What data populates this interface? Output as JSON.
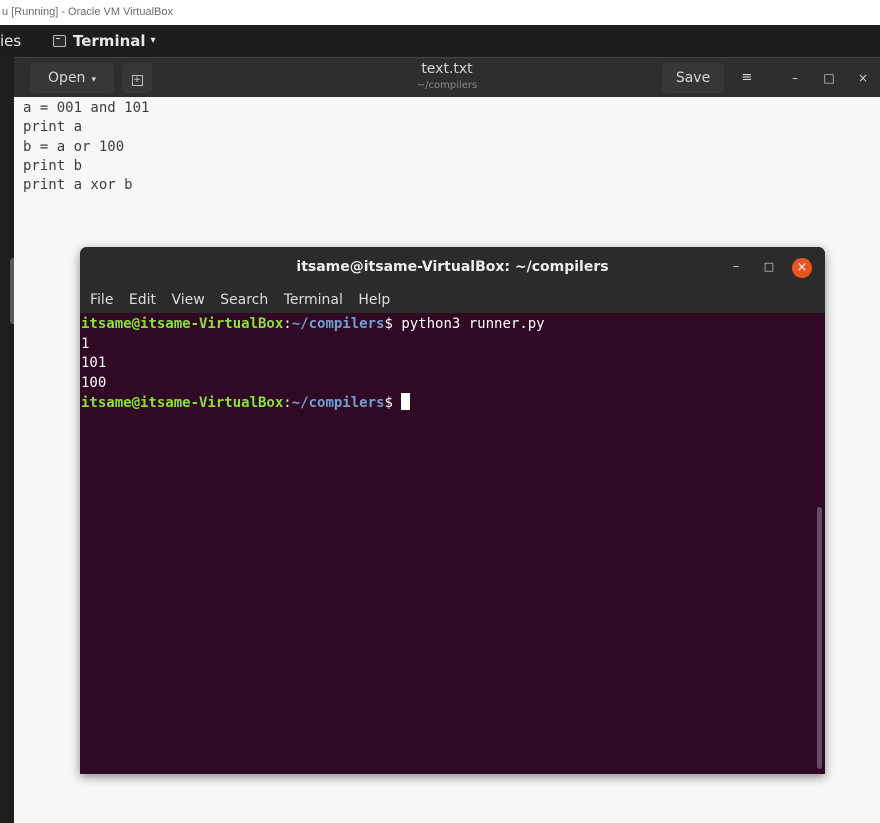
{
  "vbox": {
    "title": "u [Running] - Oracle VM VirtualBox"
  },
  "topbar": {
    "activities": "ies",
    "app_name": "Terminal",
    "app_caret": "▾"
  },
  "gedit": {
    "open_label": "Open",
    "open_caret": "▾",
    "new_tab_icon": "+",
    "title": "text.txt",
    "subtitle": "~/compilers",
    "save_label": "Save",
    "menu_icon": "≡",
    "minimize_icon": "–",
    "maximize_icon": "□",
    "close_icon": "×",
    "lines": [
      "a = 001 and 101",
      "print a",
      "b = a or 100",
      "print b",
      "print a xor b"
    ]
  },
  "terminal": {
    "title": "itsame@itsame-VirtualBox: ~/compilers",
    "minimize_icon": "–",
    "maximize_icon": "□",
    "close_icon": "×",
    "menu": [
      "File",
      "Edit",
      "View",
      "Search",
      "Terminal",
      "Help"
    ],
    "prompt_user": "itsame@itsame-VirtualBox",
    "prompt_sep": ":",
    "prompt_path": "~/compilers",
    "prompt_sym": "$ ",
    "command": "python3 runner.py",
    "output": [
      "1",
      "101",
      "100"
    ]
  }
}
